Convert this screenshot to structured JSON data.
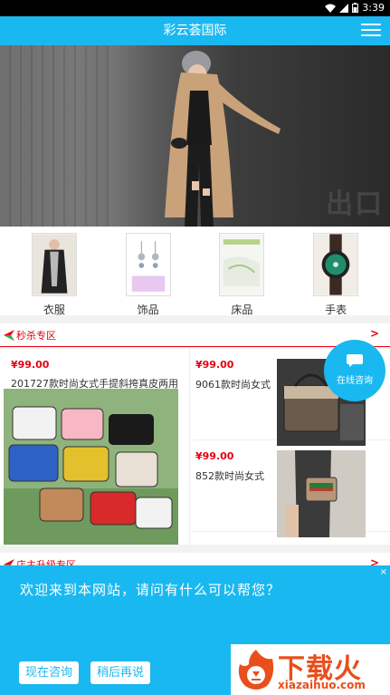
{
  "status_bar": {
    "time": "3:39"
  },
  "header": {
    "title": "彩云荟国际"
  },
  "categories": [
    {
      "label": "衣服"
    },
    {
      "label": "饰品"
    },
    {
      "label": "床品"
    },
    {
      "label": "手表"
    }
  ],
  "flash_sale": {
    "title": "秒杀专区",
    "more": ">",
    "products": [
      {
        "price": "¥99.00",
        "name": "201727款时尚女式手提斜挎真皮两用"
      },
      {
        "price": "¥99.00",
        "name": "9061款时尚女式"
      },
      {
        "price": "¥99.00",
        "name": "852款时尚女式"
      }
    ]
  },
  "upgrade_section": {
    "title": "店主升级专区",
    "more": ">"
  },
  "consult_bubble": {
    "label": "在线咨询"
  },
  "chat_popup": {
    "message": "欢迎来到本网站，请问有什么可以帮您？",
    "consult_now": "现在咨询",
    "later": "稍后再说",
    "close": "×"
  },
  "watermark": {
    "brand": "下载火",
    "domain": "xiazaihuo.com"
  },
  "colors": {
    "primary": "#1ab8f0",
    "accent_red": "#e60012",
    "brand_orange": "#e94e1b"
  }
}
